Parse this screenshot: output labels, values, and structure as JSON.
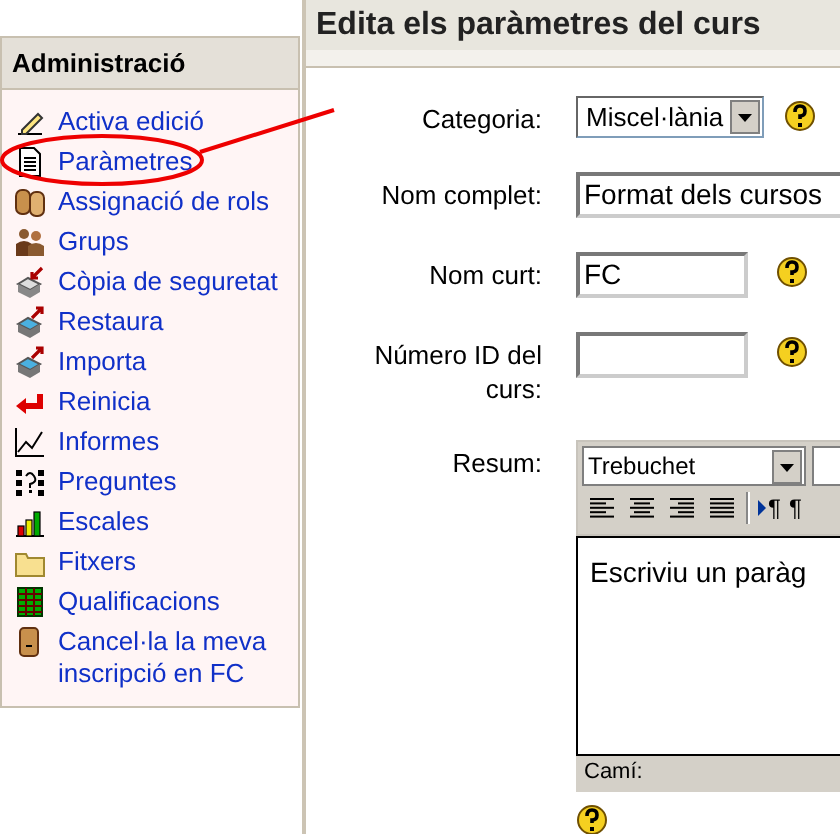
{
  "sidebar": {
    "title": "Administració",
    "items": [
      {
        "label": "Activa edició"
      },
      {
        "label": "Paràmetres"
      },
      {
        "label": "Assignació de rols"
      },
      {
        "label": "Grups"
      },
      {
        "label": "Còpia de seguretat"
      },
      {
        "label": "Restaura"
      },
      {
        "label": "Importa"
      },
      {
        "label": "Reinicia"
      },
      {
        "label": "Informes"
      },
      {
        "label": "Preguntes"
      },
      {
        "label": "Escales"
      },
      {
        "label": "Fitxers"
      },
      {
        "label": "Qualificacions"
      },
      {
        "label": "Cancel·la la meva inscripció en FC"
      }
    ]
  },
  "page": {
    "title": "Edita els paràmetres del curs"
  },
  "form": [
    {
      "kind": "select",
      "label": "Categoria:",
      "value": "Miscel·lània",
      "help": true
    },
    {
      "kind": "wide",
      "label": "Nom complet:",
      "value": "Format dels cursos",
      "help": false
    },
    {
      "kind": "text",
      "label": "Nom curt:",
      "value": "FC",
      "help": true
    },
    {
      "kind": "text",
      "label": "Número ID del curs:",
      "help": true
    },
    {
      "kind": "editor",
      "label": "Resum:",
      "font": "Trebuchet",
      "content": "Escriviu un paràg",
      "path": "Camí:",
      "help": true,
      "toolbar": [
        {
          "kind": "align-left"
        },
        {
          "kind": "align-center"
        },
        {
          "kind": "align-right"
        },
        {
          "kind": "justify"
        },
        {
          "kind": "separator"
        },
        {
          "kind": "ltr",
          "text": "¶"
        },
        {
          "kind": "rtl",
          "text": "¶"
        }
      ]
    }
  ]
}
